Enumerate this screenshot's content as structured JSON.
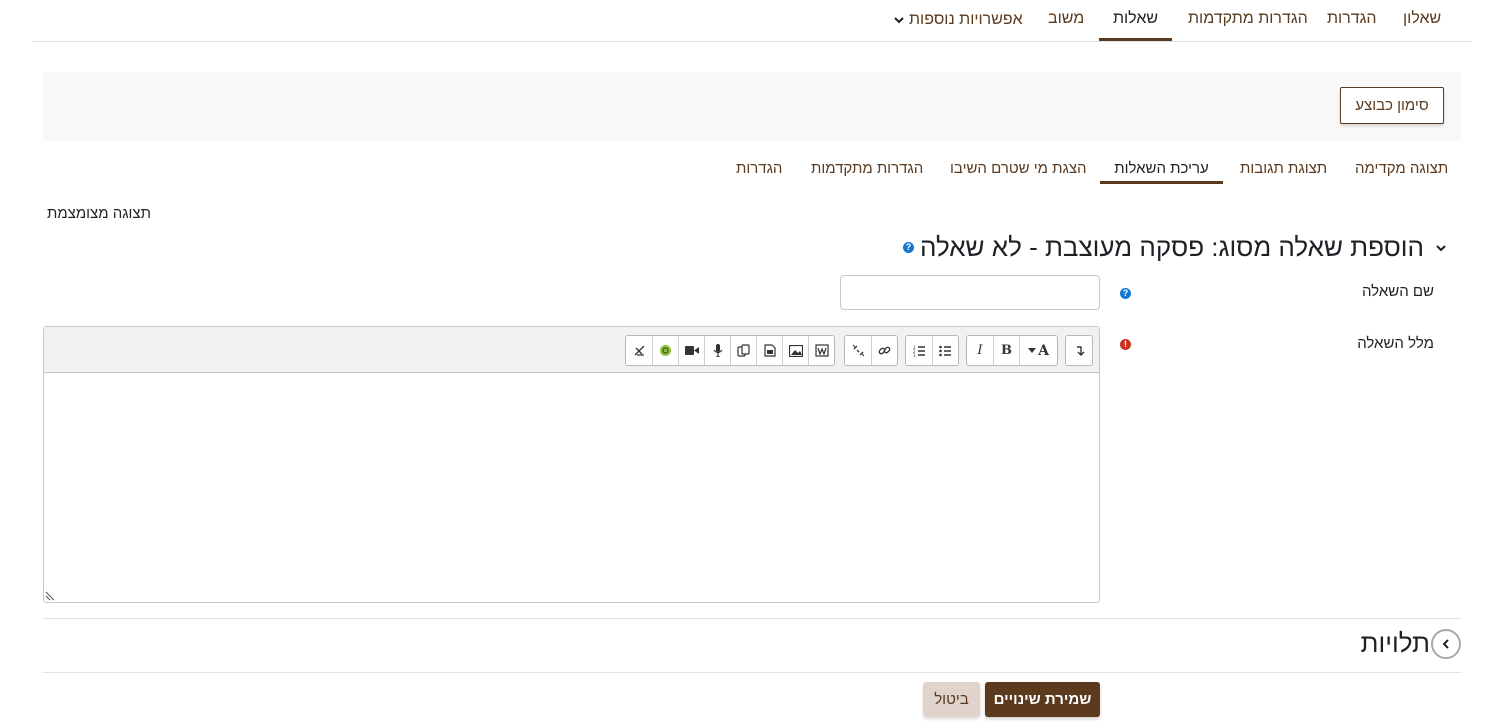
{
  "top_nav": {
    "items": [
      "שאלון",
      "הגדרות",
      "הגדרות מתקדמות",
      "שאלות",
      "משוב",
      "אפשרויות נוספות"
    ],
    "active": "שאלות"
  },
  "banner": {
    "mark_done_label": "סימון כבוצע"
  },
  "sub_nav": {
    "items": [
      "תצוגה מקדימה",
      "תצוגת תגובות",
      "עריכת השאלות",
      "הצגת מי שטרם השיבו",
      "הגדרות מתקדמות",
      "הגדרות"
    ],
    "active": "עריכת השאלות"
  },
  "collapse_all_label": "תצוגה מצומצמת",
  "section": {
    "title": "הוספת שאלה מסוג: פסקה מעוצבת - לא שאלה"
  },
  "form": {
    "name_label": "שם השאלה",
    "name_value": "",
    "text_label": "מלל השאלה"
  },
  "editor": {
    "toolbar_icons": [
      "collapse-icon",
      "font-style-icon",
      "bold-icon",
      "italic-icon",
      "unordered-list-icon",
      "ordered-list-icon",
      "link-icon",
      "unlink-icon",
      "word-import-icon",
      "image-icon",
      "media-icon",
      "manage-files-icon",
      "record-audio-icon",
      "record-video-icon",
      "h5p-icon",
      "accessibility-checker-icon"
    ],
    "bold_glyph": "B",
    "italic_glyph": "I",
    "font_glyph": "A"
  },
  "dependencies": {
    "title": "תלויות"
  },
  "buttons": {
    "save_label": "שמירת שינויים",
    "cancel_label": "ביטול"
  },
  "colors": {
    "brand": "#5b3a1e",
    "help": "#1177d1",
    "error": "#ca3120"
  }
}
